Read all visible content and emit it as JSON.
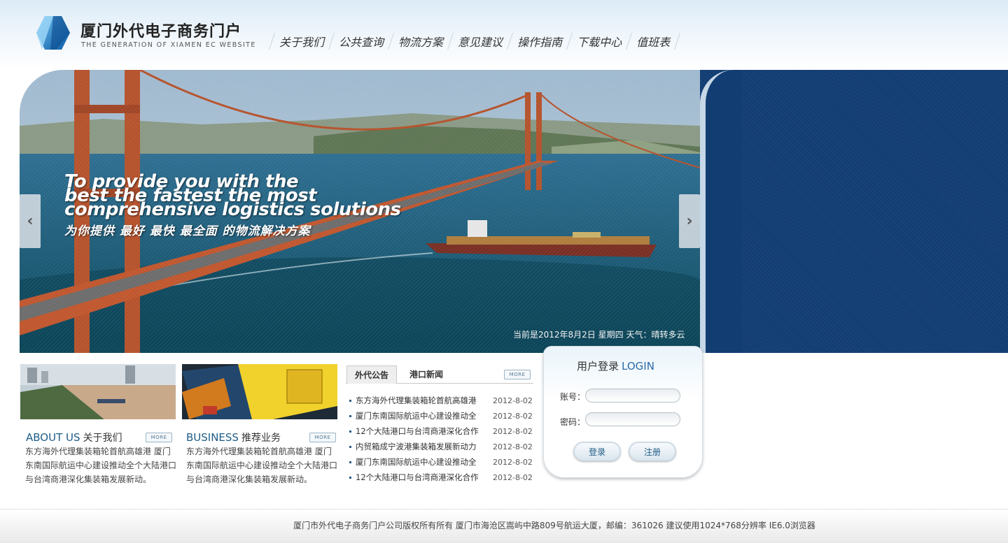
{
  "header": {
    "title": "厦门外代电子商务门户",
    "subtitle": "THE GENERATION OF XIAMEN EC WEBSITE",
    "logo_icon": "blue-gem-logo-icon",
    "nav": [
      "关于我们",
      "公共查询",
      "物流方案",
      "意见建议",
      "操作指南",
      "下载中心",
      "值班表"
    ]
  },
  "banner": {
    "headline_1": "To provide you with the",
    "headline_2": "best the fastest the most",
    "headline_3": "comprehensive logistics solutions",
    "headline_cn": "为你提供 最好 最快 最全面 的物流解决方案",
    "date_info": "当前是2012年8月2日 星期四   天气：晴转多云",
    "prev_icon": "chevron-left-icon",
    "next_icon": "chevron-right-icon",
    "prev_glyph": "‹",
    "next_glyph": "›"
  },
  "about": {
    "title_en": "ABOUT US",
    "title_cn": "关于我们",
    "more": "MORE",
    "text": "东方海外代理集装箱轮首航高雄港 厦门东南国际航运中心建设推动全个大陆港口与台湾商港深化集装箱发展新动。"
  },
  "business": {
    "title_en": "BUSINESS",
    "title_cn": "推荐业务",
    "more": "MORE",
    "text": "东方海外代理集装箱轮首航高雄港 厦门东南国际航运中心建设推动全个大陆港口与台湾商港深化集装箱发展新动。"
  },
  "news": {
    "tabs": [
      "外代公告",
      "港口新闻"
    ],
    "more": "MORE",
    "items": [
      {
        "title": "东方海外代理集装箱轮首航高雄港",
        "date": "2012-8-02"
      },
      {
        "title": "厦门东南国际航运中心建设推动全",
        "date": "2012-8-02"
      },
      {
        "title": "12个大陆港口与台湾商港深化合作",
        "date": "2012-8-02"
      },
      {
        "title": "内贸箱成宁波港集装箱发展新动力",
        "date": "2012-8-02"
      },
      {
        "title": "厦门东南国际航运中心建设推动全",
        "date": "2012-8-02"
      },
      {
        "title": "12个大陆港口与台湾商港深化合作",
        "date": "2012-8-02"
      }
    ]
  },
  "login": {
    "title_cn": "用户登录",
    "title_en": "LOGIN",
    "account_label": "账号：",
    "password_label": "密码：",
    "account_value": "",
    "password_value": "",
    "login_button": "登录",
    "register_button": "注册"
  },
  "footer": {
    "text": "厦门市外代电子商务门户公司版权所有所有   厦门市海沧区嵩屿中路809号航运大厦，邮编：361026   建议使用1024*768分辨率 IE6.0浏览器"
  },
  "colors": {
    "brand_blue": "#123d73",
    "link_blue": "#1e5c86",
    "login_blue": "#2b6ba8"
  }
}
